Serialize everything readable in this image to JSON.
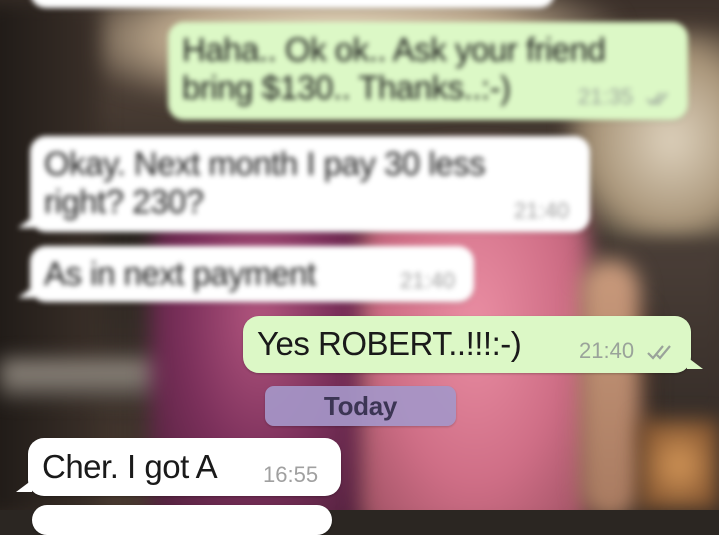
{
  "messages": [
    {
      "direction": "outgoing",
      "lines": [
        "Haha.. Ok ok.. Ask your friend",
        "bring $130.. Thanks..:-)"
      ],
      "time": "21:35",
      "ticks": "double-check-icon"
    },
    {
      "direction": "incoming",
      "lines": [
        "Okay. Next month I pay 30 less",
        "right? 230?"
      ],
      "time": "21:40"
    },
    {
      "direction": "incoming",
      "lines": [
        "As in next payment"
      ],
      "time": "21:40"
    },
    {
      "direction": "outgoing",
      "lines": [
        "Yes ROBERT..!!!:-)"
      ],
      "time": "21:40",
      "ticks": "double-check-icon"
    },
    {
      "direction": "incoming",
      "lines": [
        "Cher. I got A"
      ],
      "time": "16:55"
    }
  ],
  "date_divider": {
    "label": "Today"
  },
  "colors": {
    "outgoing_bubble": "#dcf8c6",
    "incoming_bubble": "#ffffff",
    "date_chip": "#a596c8",
    "timestamp": "#9aa39a"
  }
}
